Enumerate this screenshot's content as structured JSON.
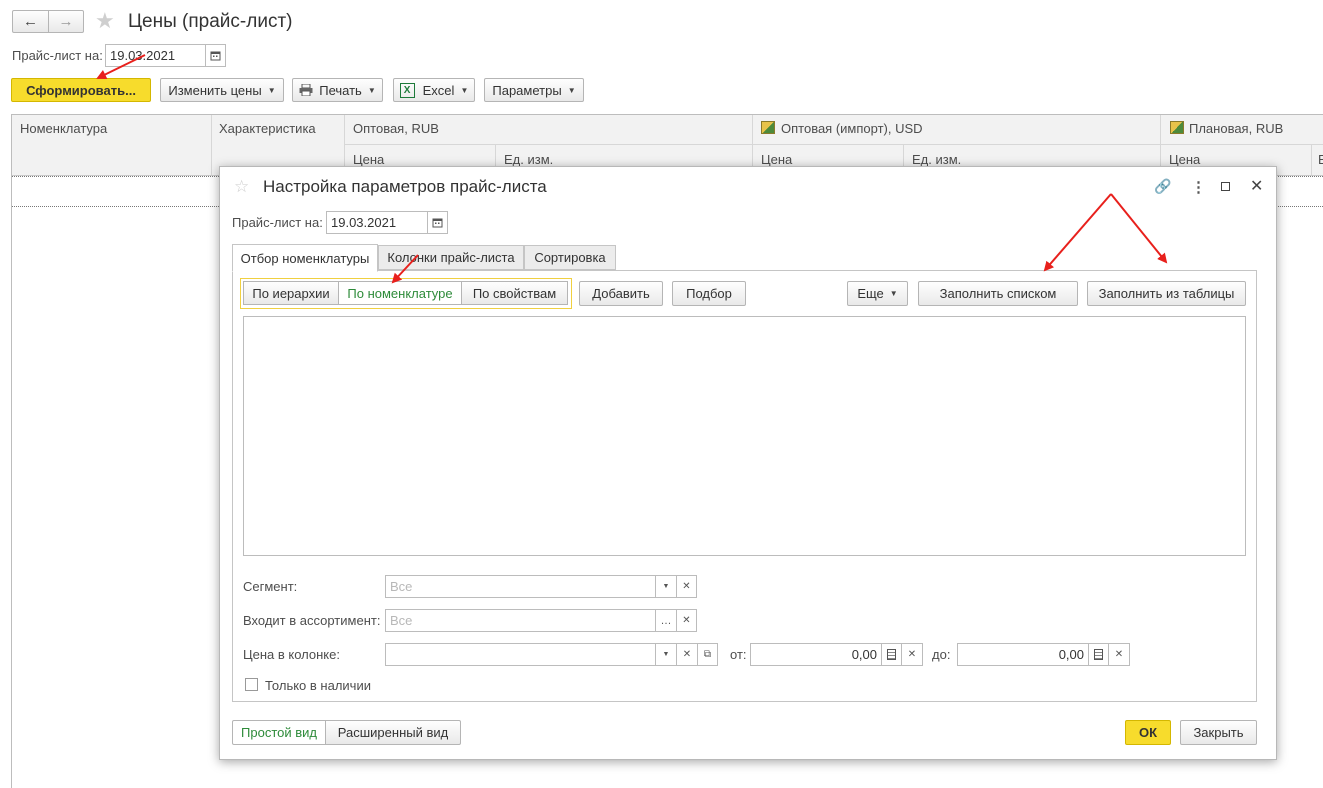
{
  "window": {
    "title": "Цены (прайс-лист)",
    "back_icon": "arrow-left-icon",
    "forward_icon": "arrow-right-icon",
    "favorite_icon": "star-icon"
  },
  "main_form": {
    "date_label": "Прайс-лист на:",
    "date_value": "19.03.2021",
    "toolbar": {
      "generate": "Сформировать...",
      "change_prices": "Изменить цены",
      "print": "Печать",
      "excel": "Excel",
      "params": "Параметры"
    },
    "table": {
      "col_nomenclature": "Номенклатура",
      "col_characteristic": "Характеристика",
      "groups": [
        {
          "name": "Оптовая, RUB"
        },
        {
          "name": "Оптовая (импорт), USD"
        },
        {
          "name": "Плановая, RUB"
        }
      ],
      "sub_price": "Цена",
      "sub_unit": "Ед. изм.",
      "sub_cut": "Е"
    }
  },
  "dialog": {
    "title": "Настройка параметров прайс-листа",
    "date_label": "Прайс-лист на:",
    "date_value": "19.03.2021",
    "tabs": [
      "Отбор номенклатуры",
      "Колонки прайс-листа",
      "Сортировка"
    ],
    "filter_modes": [
      "По иерархии",
      "По номенклатуре",
      "По свойствам"
    ],
    "add": "Добавить",
    "pick": "Подбор",
    "more": "Еще",
    "fill_list": "Заполнить списком",
    "fill_table": "Заполнить из таблицы",
    "segment_label": "Сегмент:",
    "segment_placeholder": "Все",
    "assortment_label": "Входит в ассортимент:",
    "assortment_placeholder": "Все",
    "price_col_label": "Цена в колонке:",
    "from_label": "от:",
    "from_value": "0,00",
    "to_label": "до:",
    "to_value": "0,00",
    "in_stock_label": "Только в наличии",
    "simple_view": "Простой вид",
    "extended_view": "Расширенный вид",
    "ok": "ОК",
    "close": "Закрыть"
  },
  "colors": {
    "accent_yellow": "#f7dc2c",
    "green_text": "#2e8b3a",
    "annotation_arrow": "#e8201c"
  }
}
